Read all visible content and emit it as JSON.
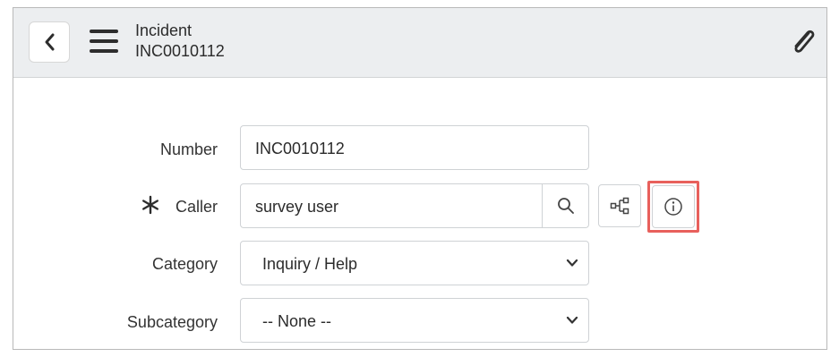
{
  "header": {
    "title": "Incident",
    "record_number": "INC0010112"
  },
  "form": {
    "number": {
      "label": "Number",
      "value": "INC0010112"
    },
    "caller": {
      "label": "Caller",
      "value": "survey user",
      "required": true
    },
    "category": {
      "label": "Category",
      "value": "Inquiry / Help"
    },
    "subcategory": {
      "label": "Subcategory",
      "value": "-- None --"
    }
  },
  "colors": {
    "header_bg": "#eceef0",
    "highlight": "#e8605c",
    "border": "#cfd2d5"
  },
  "icons": [
    "back-chevron-icon",
    "hamburger-menu-icon",
    "paperclip-icon",
    "search-icon",
    "hierarchy-icon",
    "info-icon",
    "required-asterisk-icon",
    "chevron-down-icon"
  ]
}
